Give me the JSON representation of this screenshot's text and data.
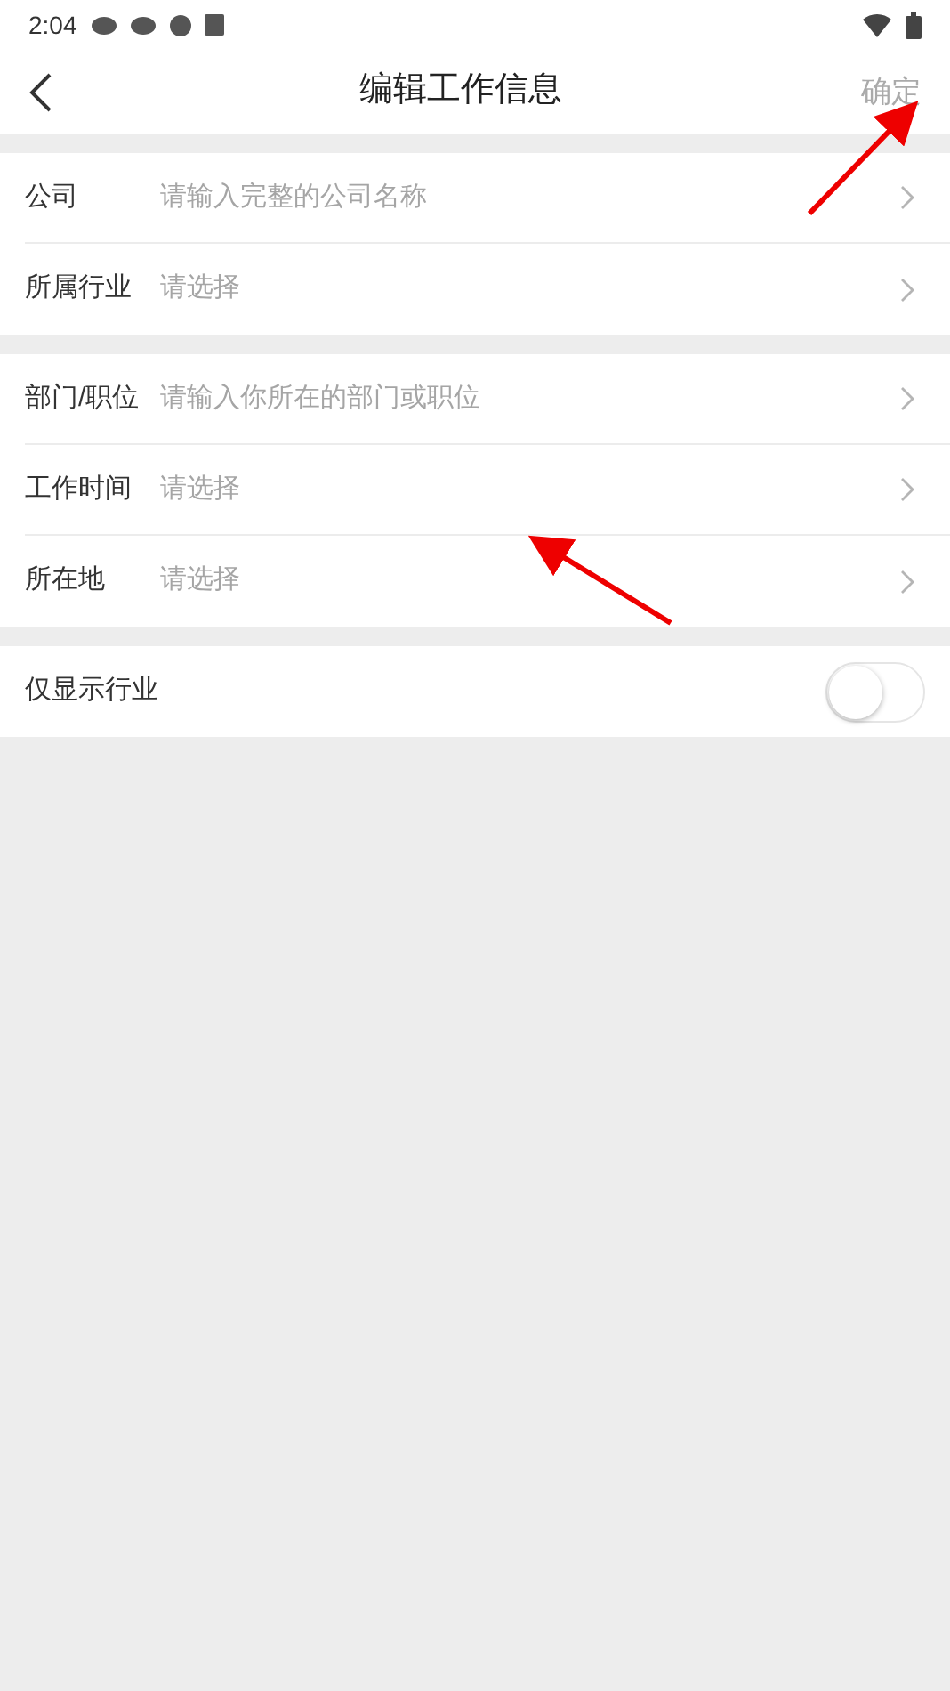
{
  "status_bar": {
    "time": "2:04"
  },
  "header": {
    "title": "编辑工作信息",
    "confirm": "确定"
  },
  "groups": [
    {
      "rows": [
        {
          "label": "公司",
          "placeholder": "请输入完整的公司名称"
        },
        {
          "label": "所属行业",
          "placeholder": "请选择"
        }
      ]
    },
    {
      "rows": [
        {
          "label": "部门/职位",
          "placeholder": "请输入你所在的部门或职位"
        },
        {
          "label": "工作时间",
          "placeholder": "请选择"
        },
        {
          "label": "所在地",
          "placeholder": "请选择"
        }
      ]
    }
  ],
  "toggle": {
    "label": "仅显示行业",
    "on": false
  }
}
